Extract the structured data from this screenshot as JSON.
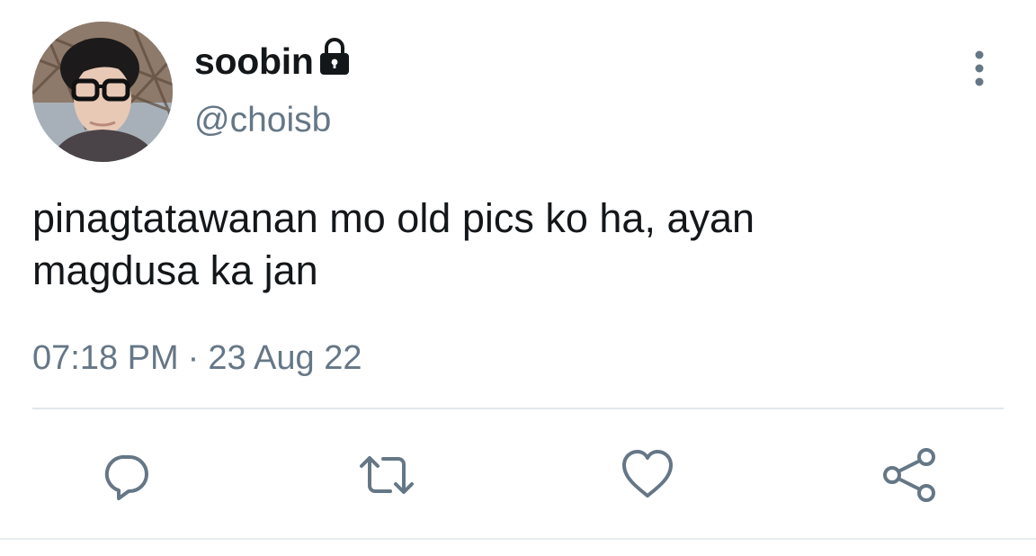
{
  "user": {
    "display_name": "soobin",
    "handle": "@choisb",
    "protected": true,
    "avatar_icon": "avatar-photo",
    "lock_icon": "lock-icon"
  },
  "tweet": {
    "text_line1": "pinagtatawanan mo old pics ko ha, ayan",
    "text_line2": "magdusa ka jan",
    "time": "07:18 PM",
    "separator": "·",
    "date": "23 Aug 22"
  },
  "menu": {
    "icon": "more-vertical-icon"
  },
  "actions": [
    {
      "name": "reply",
      "icon": "reply-icon"
    },
    {
      "name": "retweet",
      "icon": "retweet-icon"
    },
    {
      "name": "like",
      "icon": "heart-icon"
    },
    {
      "name": "share",
      "icon": "share-icon"
    }
  ],
  "colors": {
    "text_primary": "#14171a",
    "text_secondary": "#657786",
    "divider": "#e1e8ed",
    "icon_gray": "#657786",
    "background": "#ffffff"
  }
}
